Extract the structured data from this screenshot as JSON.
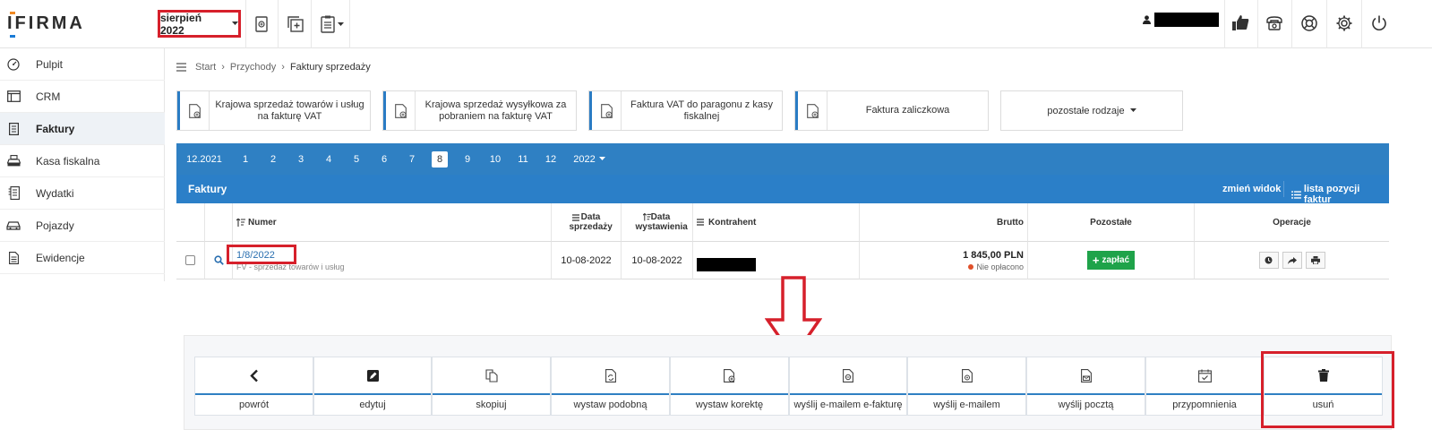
{
  "header": {
    "logo_text": "IFIRMA",
    "month_label": "sierpień 2022"
  },
  "sidebar": {
    "items": [
      {
        "label": "Pulpit",
        "icon": "dashboard-icon"
      },
      {
        "label": "CRM",
        "icon": "crm-icon"
      },
      {
        "label": "Faktury",
        "icon": "invoice-icon"
      },
      {
        "label": "Kasa fiskalna",
        "icon": "cash-register-icon"
      },
      {
        "label": "Wydatki",
        "icon": "expenses-icon"
      },
      {
        "label": "Pojazdy",
        "icon": "car-icon"
      },
      {
        "label": "Ewidencje",
        "icon": "records-icon"
      }
    ],
    "active_index": 2
  },
  "breadcrumb": {
    "items": [
      "Start",
      "Przychody",
      "Faktury sprzedaży"
    ]
  },
  "invoice_types": [
    {
      "label": "Krajowa sprzedaż towarów i usług na fakturę VAT"
    },
    {
      "label": "Krajowa sprzedaż wysyłkowa za pobraniem na fakturę VAT"
    },
    {
      "label": "Faktura VAT do paragonu z kasy fiskalnej"
    },
    {
      "label": "Faktura zaliczkowa"
    },
    {
      "label": "pozostałe rodzaje"
    }
  ],
  "months": {
    "prev": "12.2021",
    "items": [
      "1",
      "2",
      "3",
      "4",
      "5",
      "6",
      "7",
      "8",
      "9",
      "10",
      "11",
      "12"
    ],
    "selected": "8",
    "year": "2022"
  },
  "invoices_panel": {
    "title": "Faktury",
    "change_view": "zmień widok",
    "positions_list": "lista pozycji faktur"
  },
  "table": {
    "headers": {
      "number": "Numer",
      "sale_date": "Data sprzedaży",
      "issue_date": "Data wystawienia",
      "contractor": "Kontrahent",
      "gross": "Brutto",
      "remaining": "Pozostałe",
      "operations": "Operacje"
    },
    "row": {
      "number": "1/8/2022",
      "subtitle": "FV - sprzedaż towarów i usług",
      "sale_date": "10-08-2022",
      "issue_date": "10-08-2022",
      "gross": "1 845,00 PLN",
      "status": "Nie opłacono",
      "pay_label": "zapłać"
    }
  },
  "toolbar": [
    {
      "label": "powrót",
      "icon": "chevron-left-icon"
    },
    {
      "label": "edytuj",
      "icon": "edit-icon"
    },
    {
      "label": "skopiuj",
      "icon": "copy-icon"
    },
    {
      "label": "wystaw podobną",
      "icon": "similar-doc-icon"
    },
    {
      "label": "wystaw korektę",
      "icon": "correction-doc-icon"
    },
    {
      "label": "wyślij e-mailem e-fakturę",
      "icon": "e-invoice-icon"
    },
    {
      "label": "wyślij e-mailem",
      "icon": "email-doc-icon"
    },
    {
      "label": "wyślij pocztą",
      "icon": "post-doc-icon"
    },
    {
      "label": "przypomnienia",
      "icon": "reminder-icon"
    },
    {
      "label": "usuń",
      "icon": "trash-icon"
    }
  ],
  "colors": {
    "accent_blue": "#2f80c3",
    "highlight_red": "#d6202b",
    "pay_green": "#1fa34a",
    "unpaid_dot": "#e0502a"
  }
}
